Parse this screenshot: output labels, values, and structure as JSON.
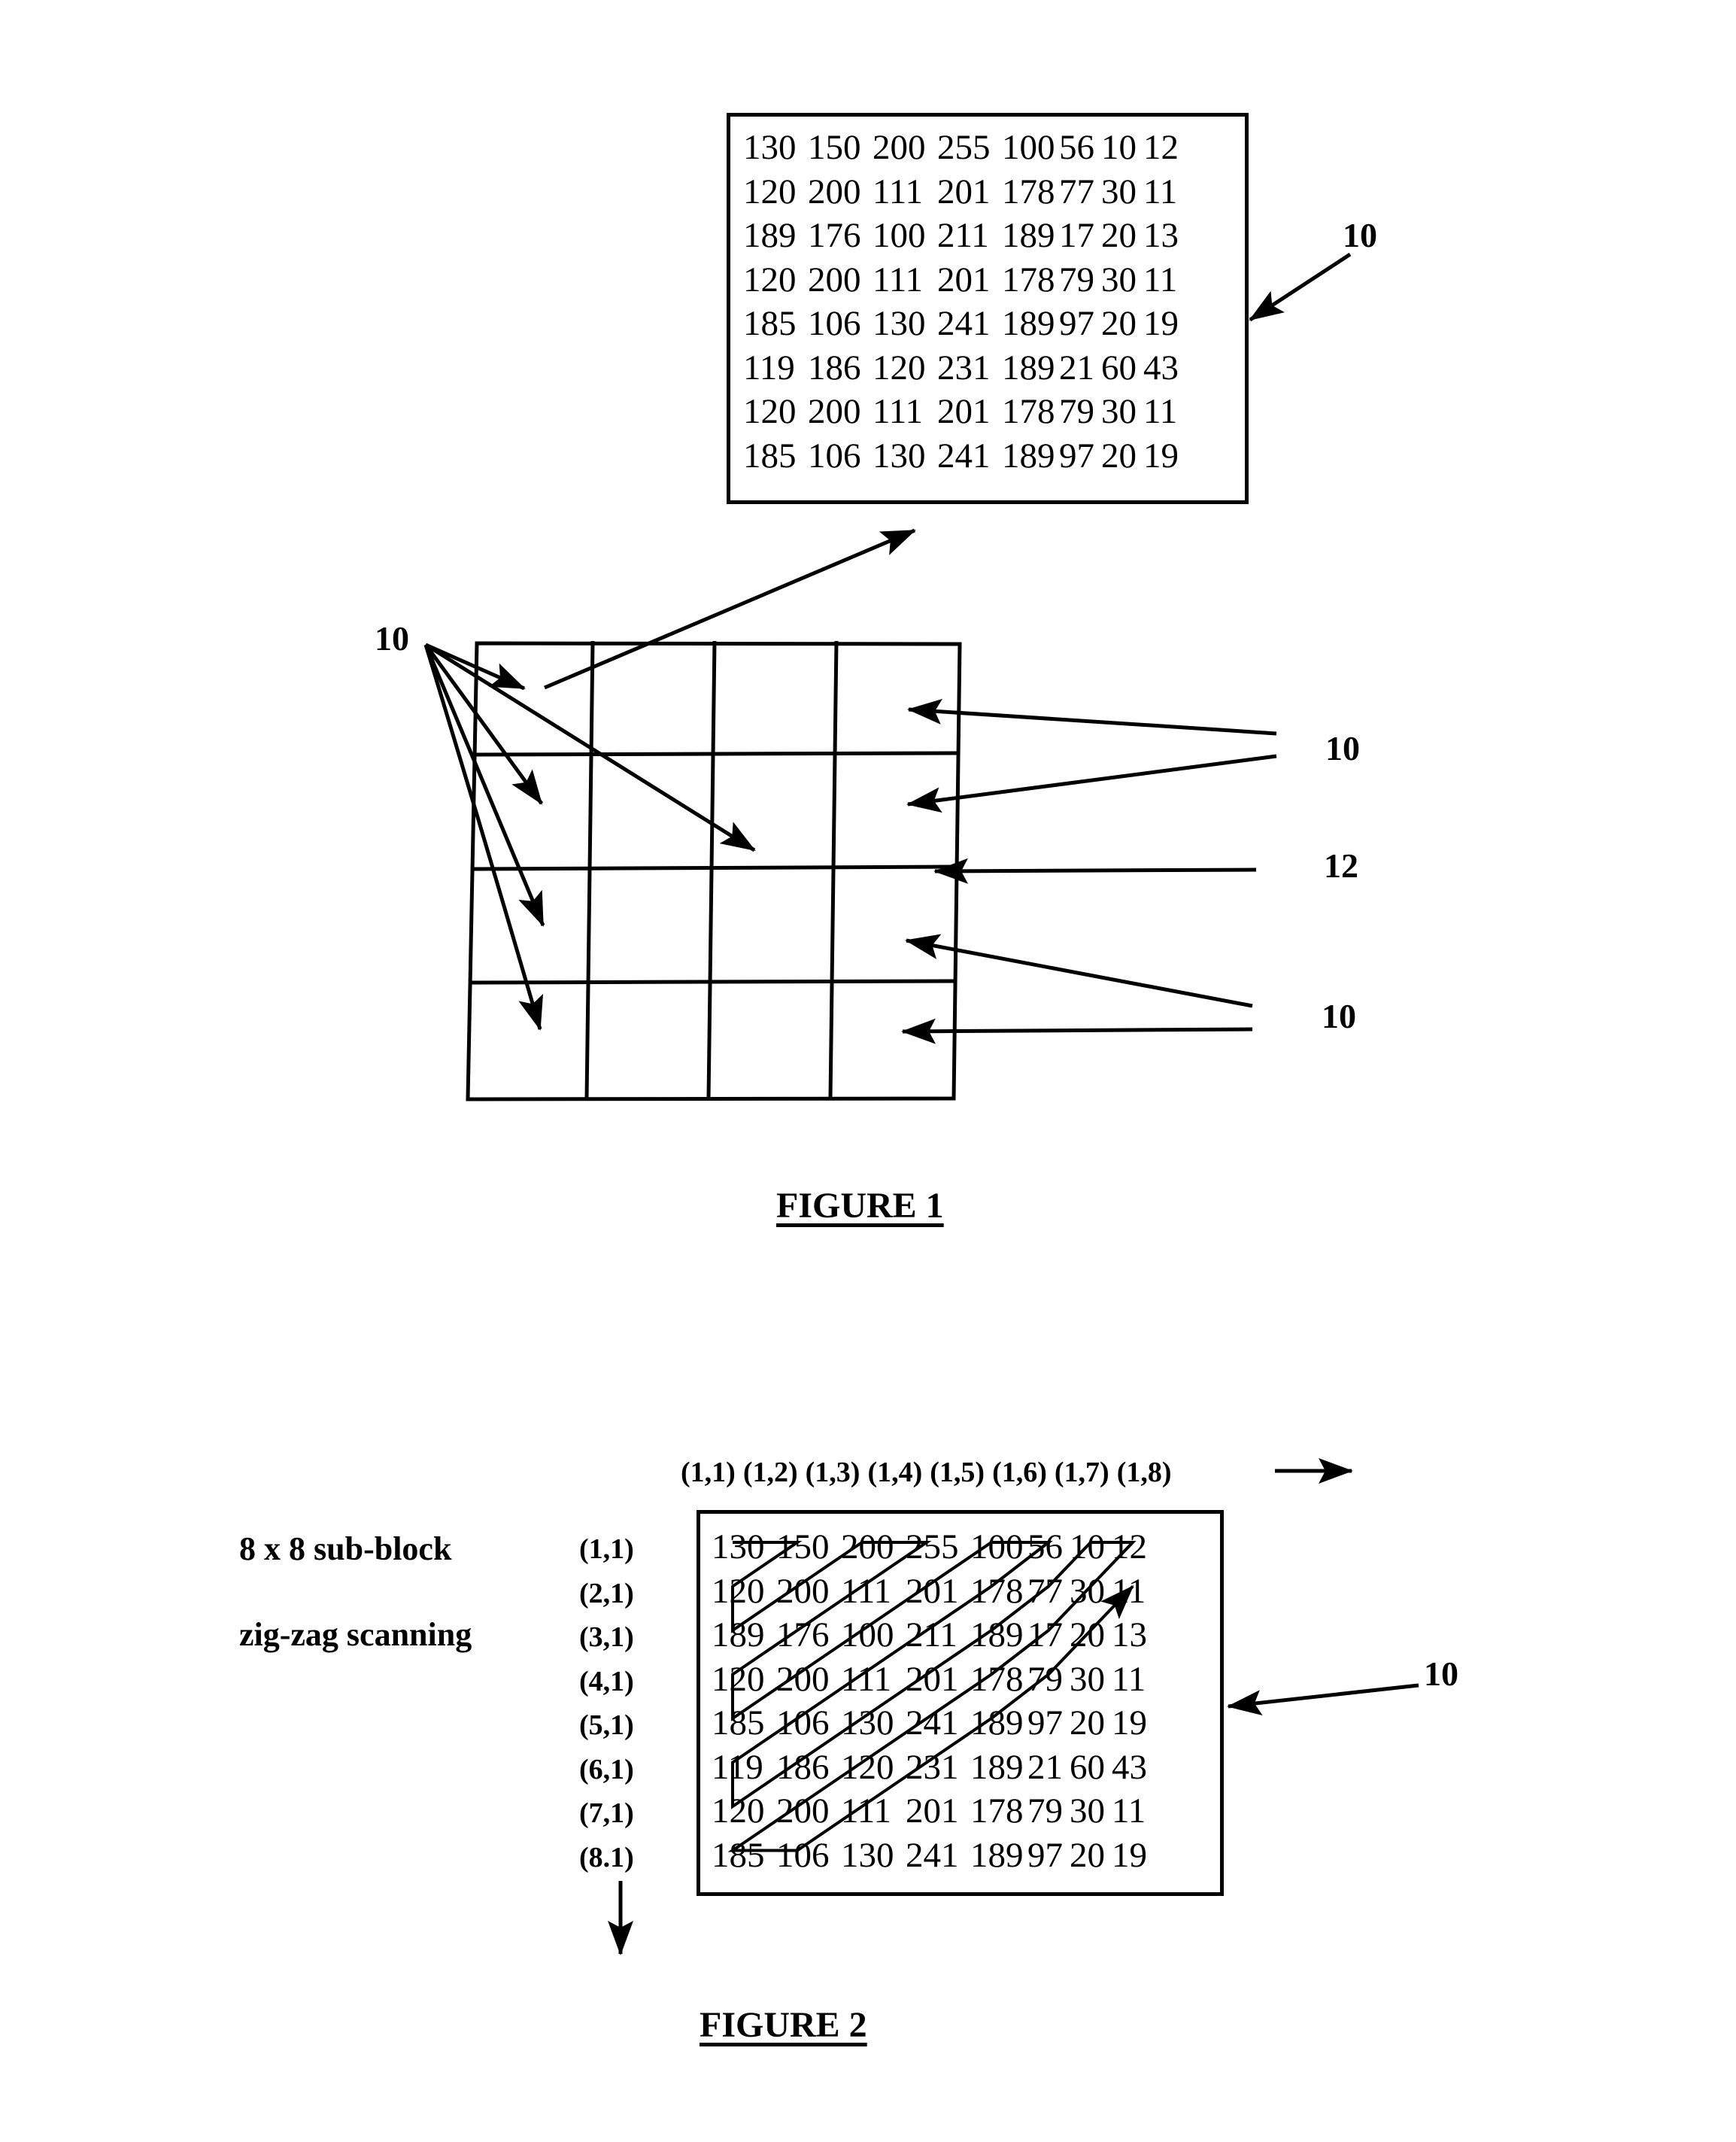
{
  "figure1": {
    "caption": "FIGURE 1",
    "matrix_block": {
      "reference": "10",
      "rows": [
        [
          "130",
          "150",
          "200",
          "255",
          "100",
          "56",
          "10",
          "12"
        ],
        [
          "120",
          "200",
          "111",
          "201",
          "178",
          "77",
          "30",
          "11"
        ],
        [
          "189",
          "176",
          "100",
          "211",
          "189",
          "17",
          "20",
          "13"
        ],
        [
          "120",
          "200",
          "111",
          "201",
          "178",
          "79",
          "30",
          "11"
        ],
        [
          "185",
          "106",
          "130",
          "241",
          "189",
          "97",
          "20",
          "19"
        ],
        [
          "119",
          "186",
          "120",
          "231",
          "189",
          "21",
          "60",
          "43"
        ],
        [
          "120",
          "200",
          "111",
          "201",
          "178",
          "79",
          "30",
          "11"
        ],
        [
          "185",
          "106",
          "130",
          "241",
          "189",
          "97",
          "20",
          "19"
        ]
      ]
    },
    "image_grid": {
      "rows": 4,
      "columns": 4,
      "reference_left": "10",
      "reference_right_top": "10",
      "reference_grid_line": "12",
      "reference_right_bottom": "10"
    }
  },
  "figure2": {
    "caption": "FIGURE 2",
    "title_line1": "8 x 8 sub-block",
    "title_line2": "zig-zag scanning",
    "reference": "10",
    "column_coords": [
      "(1,1)",
      "(1,2)",
      "(1,3)",
      "(1,4)",
      "(1,5)",
      "(1,6)",
      "(1,7)",
      "(1,8)"
    ],
    "row_coords": [
      "(1,1)",
      "(2,1)",
      "(3,1)",
      "(4,1)",
      "(5,1)",
      "(6,1)",
      "(7,1)",
      "(8.1)"
    ],
    "rows": [
      [
        "130",
        "150",
        "200",
        "255",
        "100",
        "56",
        "10",
        "12"
      ],
      [
        "120",
        "200",
        "111",
        "201",
        "178",
        "77",
        "30",
        "11"
      ],
      [
        "189",
        "176",
        "100",
        "211",
        "189",
        "17",
        "20",
        "13"
      ],
      [
        "120",
        "200",
        "111",
        "201",
        "178",
        "79",
        "30",
        "11"
      ],
      [
        "185",
        "106",
        "130",
        "241",
        "189",
        "97",
        "20",
        "19"
      ],
      [
        "119",
        "186",
        "120",
        "231",
        "189",
        "21",
        "60",
        "43"
      ],
      [
        "120",
        "200",
        "111",
        "201",
        "178",
        "79",
        "30",
        "11"
      ],
      [
        "185",
        "106",
        "130",
        "241",
        "189",
        "97",
        "20",
        "19"
      ]
    ],
    "scan_pattern": "zig-zag"
  }
}
